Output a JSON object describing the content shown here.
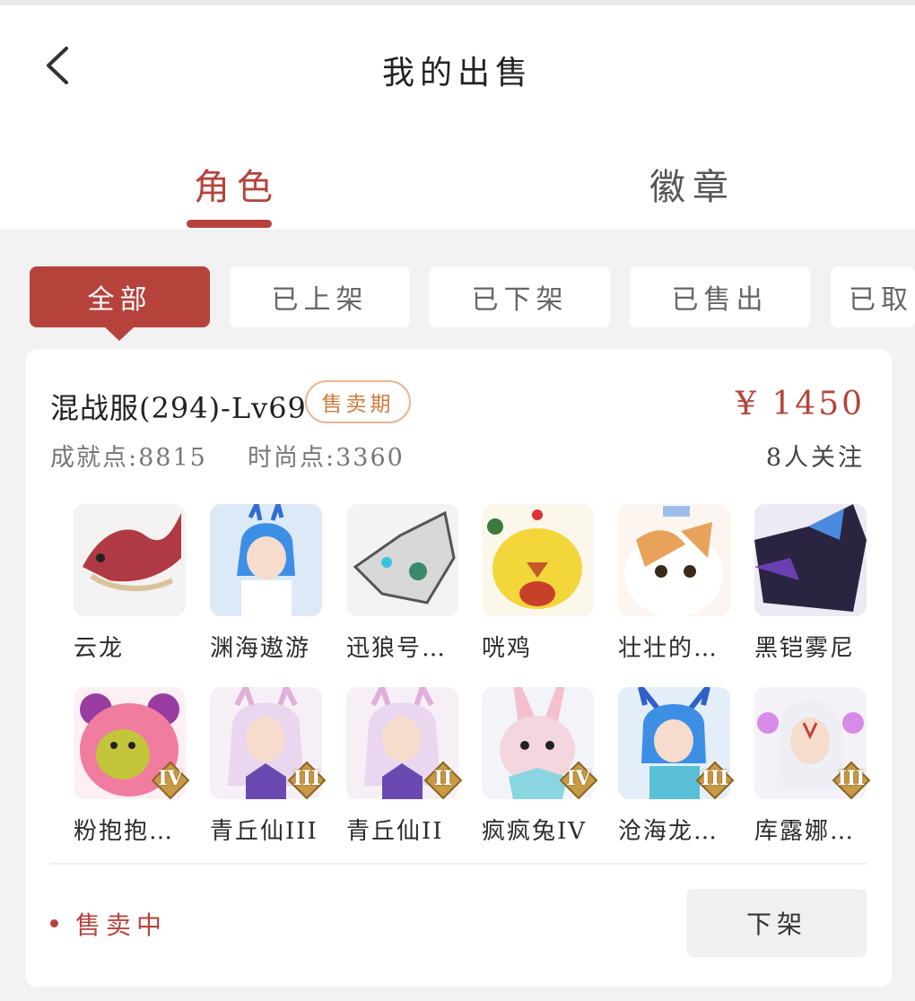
{
  "header": {
    "title": "我的出售",
    "tabs": [
      "角色",
      "徽章"
    ]
  },
  "filters": [
    "全部",
    "已上架",
    "已下架",
    "已售出",
    "已取"
  ],
  "listing": {
    "server": "混战服(294)-Lv69",
    "status_tag": "售卖期",
    "price": "¥ 1450",
    "achievement": "成就点:8815",
    "fashion": "时尚点:3360",
    "followers": "8人关注",
    "pets": [
      {
        "name": "云龙",
        "tier": ""
      },
      {
        "name": "渊海遨游",
        "tier": ""
      },
      {
        "name": "迅狼号…",
        "tier": ""
      },
      {
        "name": "咣鸡",
        "tier": ""
      },
      {
        "name": "壮壮的…",
        "tier": ""
      },
      {
        "name": "黑铠雾尼",
        "tier": ""
      },
      {
        "name": "粉抱抱…",
        "tier": "IV"
      },
      {
        "name": "青丘仙III",
        "tier": "III"
      },
      {
        "name": "青丘仙II",
        "tier": "II"
      },
      {
        "name": "疯疯兔IV",
        "tier": "IV"
      },
      {
        "name": "沧海龙…",
        "tier": "III"
      },
      {
        "name": "库露娜…",
        "tier": "III"
      }
    ],
    "sale_status": "售卖中",
    "action_label": "下架"
  },
  "colors": {
    "accent": "#b5433c",
    "tag_orange": "#d07a3a",
    "tier_gold": "#c99a45"
  }
}
